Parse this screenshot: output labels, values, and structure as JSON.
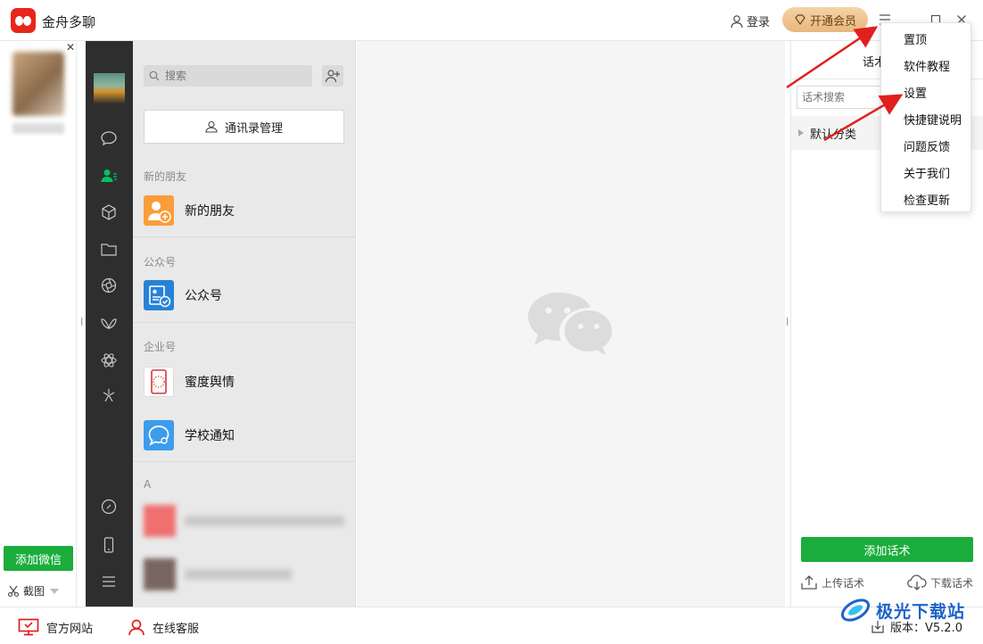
{
  "app": {
    "title": "金舟多聊"
  },
  "titlebar": {
    "login_label": "登录",
    "vip_label": "开通会员"
  },
  "account_column": {
    "add_wechat_label": "添加微信",
    "screenshot_label": "截图"
  },
  "contacts": {
    "search_placeholder": "搜索",
    "manage_label": "通讯录管理",
    "sections": [
      {
        "label": "新的朋友",
        "items": [
          "新的朋友"
        ]
      },
      {
        "label": "公众号",
        "items": [
          "公众号"
        ]
      },
      {
        "label": "企业号",
        "items": [
          "蜜度舆情",
          "学校通知"
        ]
      }
    ],
    "group_letter": "A"
  },
  "right_panel": {
    "title": "话术",
    "search_placeholder": "话术搜索",
    "category": "默认分类",
    "add_label": "添加话术",
    "upload_label": "上传话术",
    "download_label": "下载话术"
  },
  "menu": {
    "items": [
      "置顶",
      "软件教程",
      "设置",
      "快捷键说明",
      "问题反馈",
      "关于我们",
      "检查更新"
    ]
  },
  "footer": {
    "website_label": "官方网站",
    "service_label": "在线客服",
    "version_label": "版本：V5.2.0"
  },
  "watermark": {
    "text": "极光下载站"
  },
  "colors": {
    "brand_red": "#e8261c",
    "green": "#1aad3c",
    "wx_sidebar": "#2e2e2e",
    "arrow_red": "#e0201d"
  }
}
